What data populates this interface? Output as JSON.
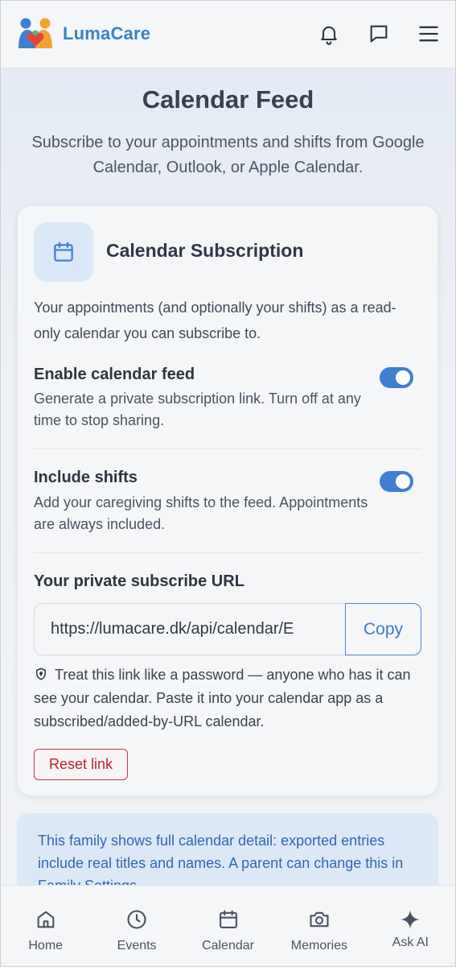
{
  "app": {
    "name": "LumaCare"
  },
  "header": {
    "icons": [
      "bell-icon",
      "chat-icon",
      "menu-icon"
    ]
  },
  "page": {
    "title": "Calendar Feed",
    "subtitle": "Subscribe to your appointments and shifts from Google Calendar, Outlook, or Apple Calendar."
  },
  "card": {
    "icon": "calendar-icon",
    "title": "Calendar Subscription",
    "description": "Your appointments (and optionally your shifts) as a read-only calendar you can subscribe to.",
    "settings": [
      {
        "title": "Enable calendar feed",
        "description": "Generate a private subscription link. Turn off at any time to stop sharing.",
        "enabled": true
      },
      {
        "title": "Include shifts",
        "description": "Add your caregiving shifts to the feed. Appointments are always included.",
        "enabled": true
      }
    ],
    "url_label": "Your private subscribe URL",
    "url_value": "https://lumacare.dk/api/calendar/E",
    "copy_label": "Copy",
    "warning": "Treat this link like a password — anyone who has it can see your calendar. Paste it into your calendar app as a subscribed/added-by-URL calendar.",
    "reset_label": "Reset link"
  },
  "info_banner": {
    "text": "This family shows full calendar detail: exported entries include real titles and names. A parent can change this in Family Settings."
  },
  "bottom_nav": [
    {
      "label": "Home",
      "icon": "home-icon"
    },
    {
      "label": "Events",
      "icon": "clock-icon"
    },
    {
      "label": "Calendar",
      "icon": "calendar-icon"
    },
    {
      "label": "Memories",
      "icon": "camera-icon"
    },
    {
      "label": "Ask AI",
      "icon": "sparkle-icon"
    }
  ],
  "colors": {
    "brand": "#3b82c4",
    "toggle_on": "#3f7fd1",
    "danger": "#c0202f",
    "banner_bg": "#dce8f6"
  }
}
